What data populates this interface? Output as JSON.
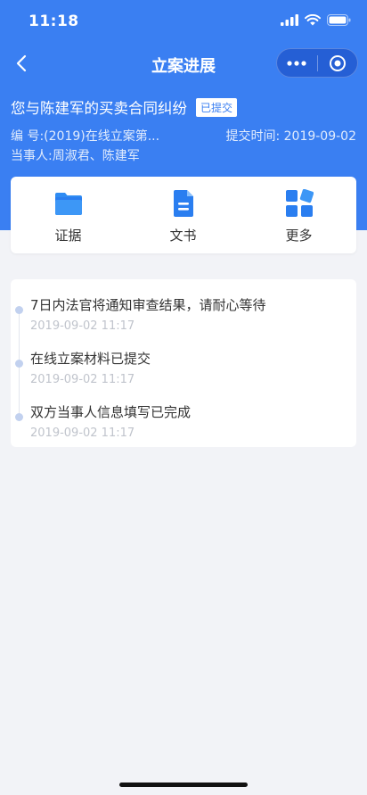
{
  "status_bar": {
    "time": "11:18"
  },
  "nav": {
    "title": "立案进展",
    "icons": [
      "back-chevron-icon",
      "more-dots-icon",
      "target-circle-icon"
    ]
  },
  "case": {
    "title": "您与陈建军的买卖合同纠纷",
    "status": "已提交",
    "number_label": "编  号:",
    "number_value": "(2019)在线立案第...",
    "submit_label": "提交时间:",
    "submit_value": "2019-09-02",
    "party_label": "当事人:",
    "party_value": "周淑君、陈建军"
  },
  "actions": [
    {
      "label": "证据",
      "icon": "folder-icon"
    },
    {
      "label": "文书",
      "icon": "document-icon"
    },
    {
      "label": "更多",
      "icon": "grid-more-icon"
    }
  ],
  "timeline": [
    {
      "text": "7日内法官将通知审查结果，请耐心等待",
      "time": "2019-09-02 11:17"
    },
    {
      "text": "在线立案材料已提交",
      "time": "2019-09-02 11:17"
    },
    {
      "text": "双方当事人信息填写已完成",
      "time": "2019-09-02 11:17"
    }
  ],
  "colors": {
    "primary": "#3a7ff2",
    "background": "#f2f3f7",
    "timeline_dot": "#c2d1ef"
  }
}
